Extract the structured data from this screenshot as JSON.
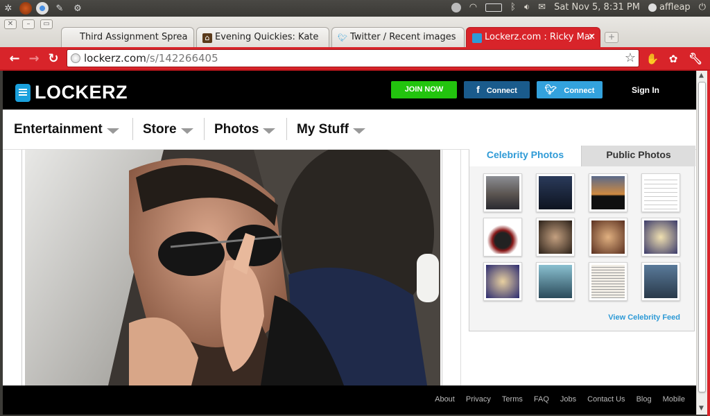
{
  "panel": {
    "clock": "Sat Nov  5,  8:31 PM",
    "user": "affleap"
  },
  "browser": {
    "tabs": [
      {
        "label": "Third Assignment Sprea",
        "icon": "spreadsheet-icon"
      },
      {
        "label": "Evening Quickies: Kate",
        "icon": "blog-icon"
      },
      {
        "label": "Twitter / Recent images",
        "icon": "twitter-bird-icon"
      },
      {
        "label": "Lockerz.com : Ricky Mar",
        "icon": "lockerz-icon",
        "active": true
      }
    ],
    "url_host": "lockerz.com",
    "url_path": "/s/142266405"
  },
  "site": {
    "logo_text": "LOCKERZ",
    "join_label": "JOIN NOW",
    "facebook_label": "Connect",
    "twitter_label": "Connect",
    "signin_label": "Sign In",
    "nav": [
      {
        "label": "Entertainment"
      },
      {
        "label": "Store"
      },
      {
        "label": "Photos"
      },
      {
        "label": "My Stuff"
      }
    ],
    "side_tabs": {
      "active": "Celebrity Photos",
      "inactive": "Public Photos"
    },
    "view_feed_label": "View Celebrity Feed",
    "footer_links": [
      "About",
      "Privacy",
      "Terms",
      "FAQ",
      "Jobs",
      "Contact Us",
      "Blog",
      "Mobile"
    ]
  },
  "colors": {
    "browser_red": "#d8242a",
    "lockerz_blue": "#2e9ad6",
    "join_green": "#22c40e",
    "facebook_blue": "#1a5b8c",
    "twitter_blue": "#33a2dd"
  }
}
